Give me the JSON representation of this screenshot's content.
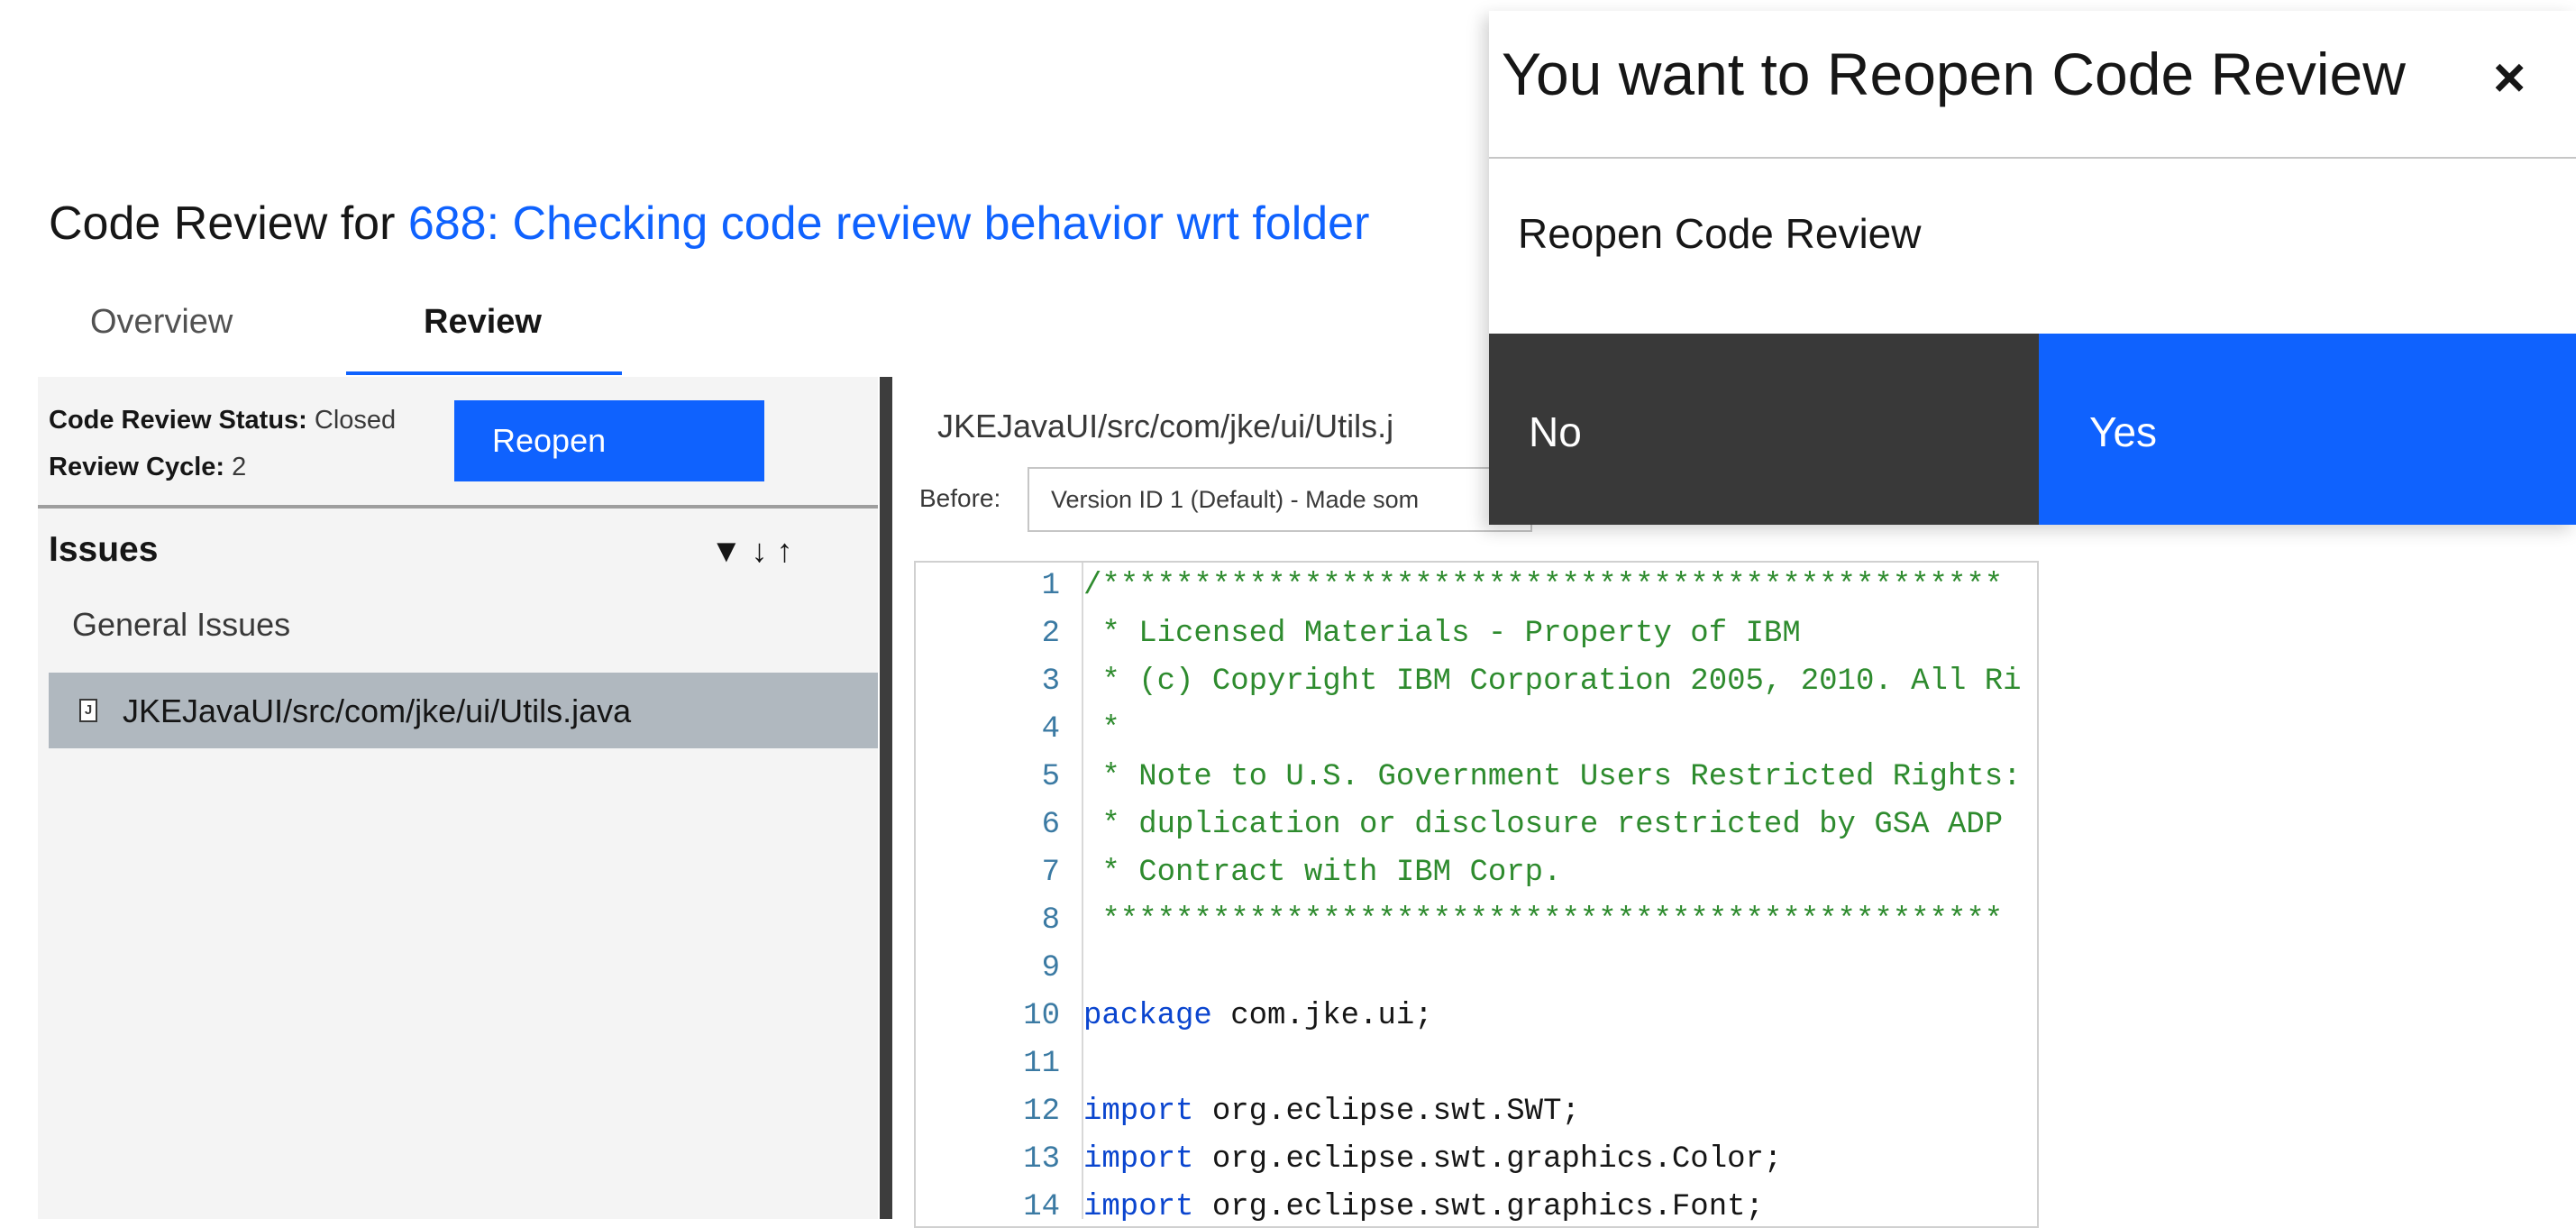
{
  "header": {
    "title_prefix": "Code Review for ",
    "work_item_link": "688: Checking code review behavior wrt folder"
  },
  "tabs": [
    {
      "label": "Overview",
      "selected": false
    },
    {
      "label": "Review",
      "selected": true
    }
  ],
  "review_status": {
    "status_label": "Code Review Status:",
    "status_value": " Closed",
    "cycle_label": "Review Cycle:",
    "cycle_value": " 2",
    "reopen_label": "Reopen"
  },
  "issues": {
    "heading": "Issues",
    "tool_icons": [
      "filter-icon",
      "arrow-down-icon",
      "arrow-up-icon"
    ],
    "tool_glyphs": "▼↓↑",
    "general_label": "General Issues",
    "file_icon_glyph": "J",
    "file_label": "JKEJavaUI/src/com/jke/ui/Utils.java"
  },
  "code_view": {
    "file_path": "JKEJavaUI/src/com/jke/ui/Utils.j",
    "before_label": "Before:",
    "version_selected": "Version ID 1 (Default) - Made som",
    "lines": [
      {
        "no": "1",
        "type": "comment",
        "text": "/*************************************************"
      },
      {
        "no": "2",
        "type": "comment",
        "text": " * Licensed Materials - Property of IBM"
      },
      {
        "no": "3",
        "type": "comment",
        "text": " * (c) Copyright IBM Corporation 2005, 2010. All Ri"
      },
      {
        "no": "4",
        "type": "comment",
        "text": " *"
      },
      {
        "no": "5",
        "type": "comment",
        "text": " * Note to U.S. Government Users Restricted Rights:"
      },
      {
        "no": "6",
        "type": "comment",
        "text": " * duplication or disclosure restricted by GSA ADP"
      },
      {
        "no": "7",
        "type": "comment",
        "text": " * Contract with IBM Corp."
      },
      {
        "no": "8",
        "type": "comment",
        "text": " *************************************************"
      },
      {
        "no": "9",
        "type": "plain",
        "text": ""
      },
      {
        "no": "10",
        "type": "code",
        "keyword": "package",
        "rest": " com.jke.ui;"
      },
      {
        "no": "11",
        "type": "plain",
        "text": ""
      },
      {
        "no": "12",
        "type": "code",
        "keyword": "import",
        "rest": " org.eclipse.swt.SWT;"
      },
      {
        "no": "13",
        "type": "code",
        "keyword": "import",
        "rest": " org.eclipse.swt.graphics.Color;"
      },
      {
        "no": "14",
        "type": "code",
        "keyword": "import",
        "rest": " org.eclipse.swt.graphics.Font;"
      }
    ]
  },
  "dialog": {
    "title": "You want to Reopen Code Review",
    "close_glyph": "×",
    "body": "Reopen Code Review",
    "no_label": "No",
    "yes_label": "Yes"
  },
  "colors": {
    "accent": "#0f62fe",
    "secondary_button": "#393939",
    "selected_row": "#b0b8bf",
    "comment": "#2e8b2e",
    "keyword": "#0a45cf"
  }
}
